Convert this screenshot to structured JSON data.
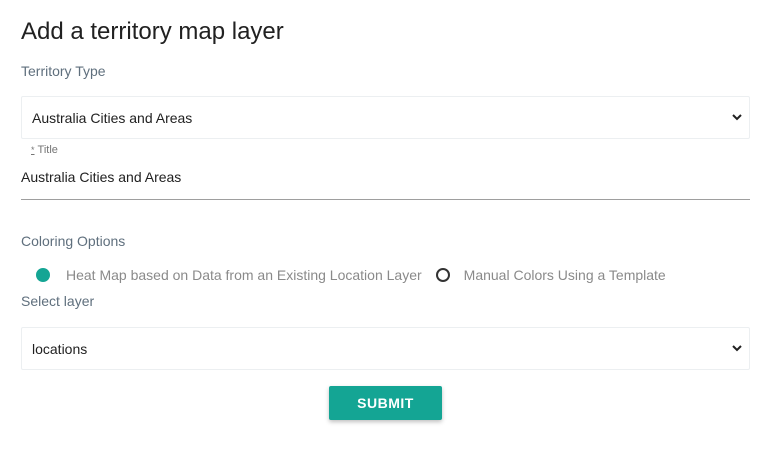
{
  "page": {
    "title": "Add a territory map layer"
  },
  "territory_type": {
    "label": "Territory Type",
    "selected": "Australia Cities and Areas",
    "icon": "chevron-down-icon"
  },
  "title_field": {
    "required_mark": "*",
    "label": "Title",
    "value": "Australia Cities and Areas"
  },
  "coloring": {
    "label": "Coloring Options",
    "options": [
      {
        "label": "Heat Map based on Data from an Existing Location Layer",
        "checked": true
      },
      {
        "label": "Manual Colors Using a Template",
        "checked": false
      }
    ]
  },
  "layer_select": {
    "label": "Select layer",
    "selected": "locations",
    "icon": "chevron-down-icon"
  },
  "submit": {
    "label": "SUBMIT"
  },
  "colors": {
    "accent": "#14a594",
    "label_text": "#5f6f7d",
    "muted_text": "#8a8a8a"
  }
}
